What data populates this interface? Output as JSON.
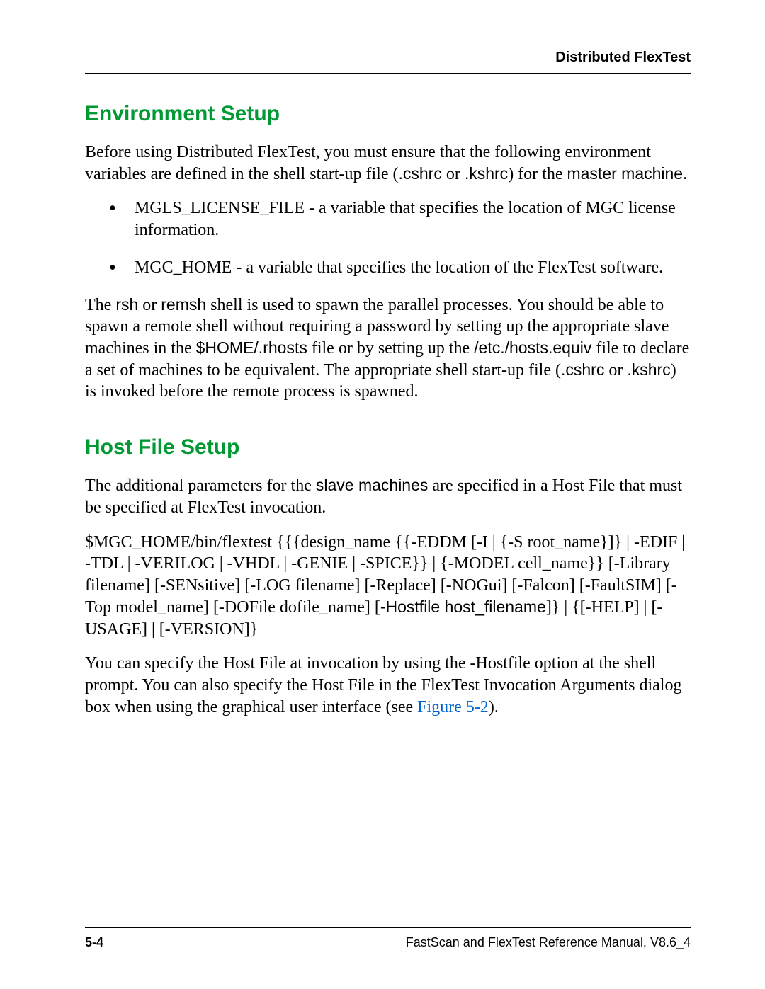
{
  "header": {
    "title": "Distributed FlexTest"
  },
  "section1": {
    "heading": "Environment Setup",
    "para1_a": "Before using Distributed FlexTest, you must ensure that the following environment variables are defined in the shell start-up file (",
    "para1_b": ".cshrc",
    "para1_c": " or ",
    "para1_d": ".kshrc",
    "para1_e": ") for the ",
    "para1_f": "master machine",
    "para1_g": ".",
    "bullet1": "MGLS_LICENSE_FILE - a variable that specifies the location of MGC license information.",
    "bullet2": "MGC_HOME - a variable that specifies the location of the FlexTest software.",
    "para2_a": "The ",
    "para2_b": "rsh",
    "para2_c": " or ",
    "para2_d": "remsh",
    "para2_e": " shell is used to spawn the parallel processes. You should be able to spawn a remote shell without requiring a password by setting up the appropriate slave machines in the ",
    "para2_f": "$HOME/.rhosts",
    "para2_g": " file or by setting up the ",
    "para2_h": "/etc./hosts.equiv",
    "para2_i": " file to declare a set of machines to be equivalent. The appropriate shell start-up file (",
    "para2_j": ".cshrc",
    "para2_k": " or ",
    "para2_l": ".kshrc",
    "para2_m": ") is invoked before the remote process is spawned."
  },
  "section2": {
    "heading": "Host File Setup",
    "para1_a": "The additional parameters for the ",
    "para1_b": "slave machines",
    "para1_c": " are specified in a Host File that must be specified at FlexTest invocation.",
    "cmd_a": "$MGC_HOME/bin/flextest {{{design_name {{-EDDM [-I | {-S root_name}]} | -EDIF | -TDL | -VERILOG | -VHDL | -GENIE | -SPICE}} | {-MODEL cell_name}} [-Library filename] [-SENsitive] [-LOG filename] [-Replace] [-NOGui] [-Falcon] [-FaultSIM] [-Top model_name] [-DOFile dofile_name] [",
    "cmd_b": "-Hostfile host_filename",
    "cmd_c": "]} | {[-HELP] | [-USAGE] | [-VERSION]}",
    "para2_a": "You can specify the Host File at invocation by using the -Hostfile option at the shell prompt. You can also specify the Host File in the FlexTest Invocation Arguments dialog box when using the graphical user interface (see ",
    "para2_link": "Figure 5-2",
    "para2_b": ")."
  },
  "footer": {
    "left": "5-4",
    "right": "FastScan and FlexTest Reference Manual, V8.6_4"
  }
}
